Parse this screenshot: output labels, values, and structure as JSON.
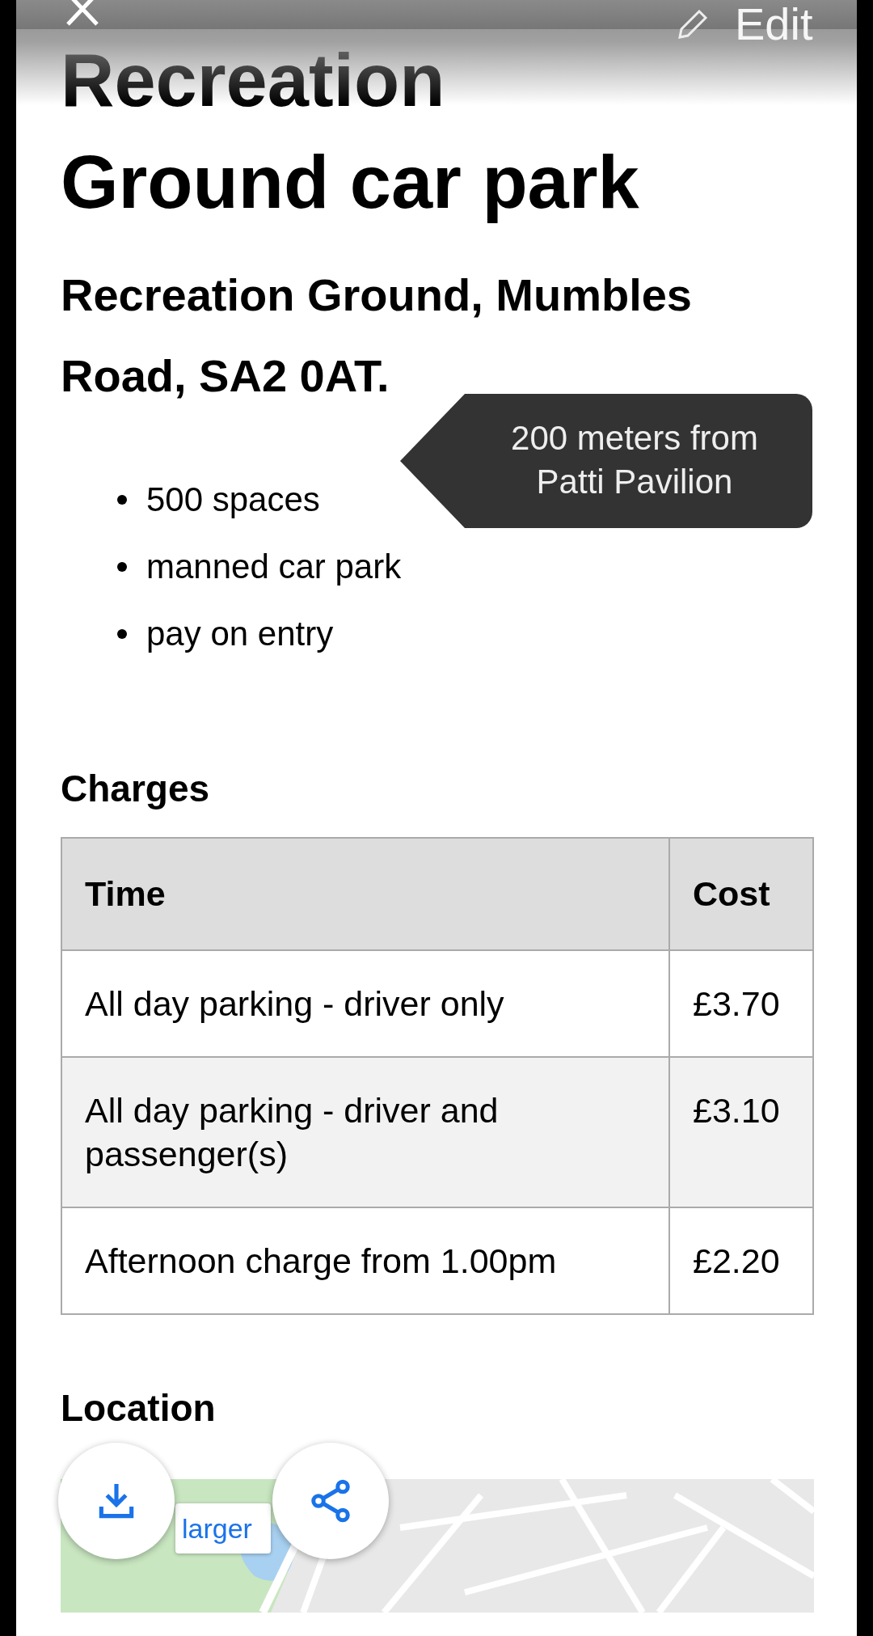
{
  "overlay": {
    "edit_label": "Edit"
  },
  "title": "Recreation Ground car park",
  "address": "Recreation Ground, Mumbles Road, SA2 0AT.",
  "features": [
    "500 spaces",
    "manned car park",
    "pay on entry"
  ],
  "tooltip": "200 meters from Patti Pavilion",
  "charges": {
    "heading": "Charges",
    "columns": [
      "Time",
      "Cost"
    ],
    "rows": [
      {
        "time": "All day parking - driver only",
        "cost": "£3.70"
      },
      {
        "time": "All day parking - driver and passenger(s)",
        "cost": "£3.10"
      },
      {
        "time": "Afternoon charge from 1.00pm",
        "cost": "£2.20"
      }
    ]
  },
  "location": {
    "heading": "Location",
    "map_button": "larger"
  }
}
